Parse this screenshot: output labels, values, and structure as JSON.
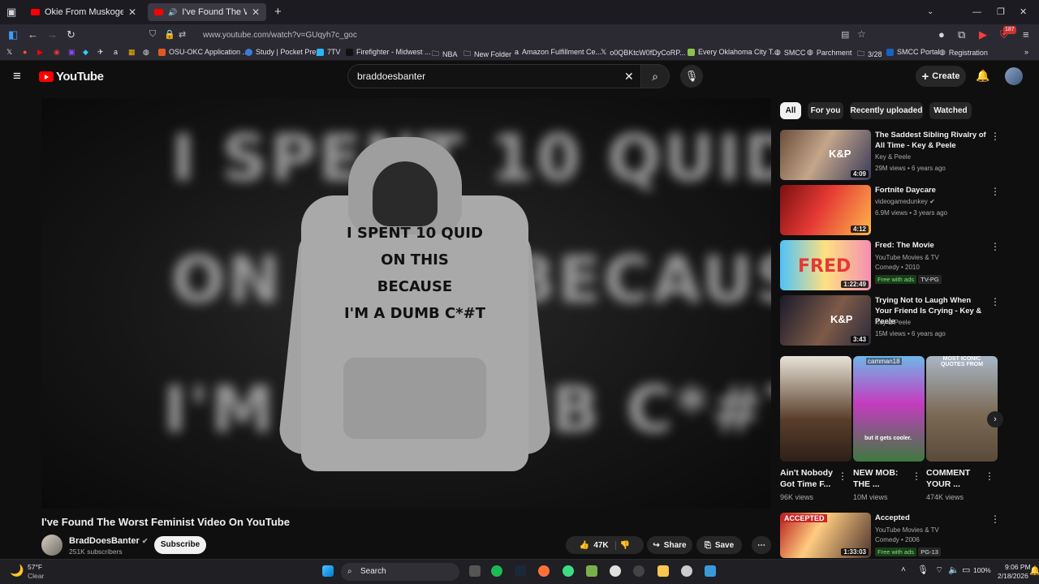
{
  "browser": {
    "tabs": [
      {
        "label": "Okie From Muskogee - YouTube"
      },
      {
        "label": "I've Found The Worst Femini"
      }
    ],
    "url": "www.youtube.com/watch?v=GUqyh7c_goc",
    "extension_badge": "187",
    "bookmarks": [
      {
        "label": "OSU-OKC Application ..."
      },
      {
        "label": "Study | Pocket Prep"
      },
      {
        "label": "7TV"
      },
      {
        "label": "Firefighter - Midwest ..."
      },
      {
        "label": "NBA"
      },
      {
        "label": "New Folder"
      },
      {
        "label": "Amazon Fulfillment Ce..."
      },
      {
        "label": "o0QBKtcW0fDyCoRP..."
      },
      {
        "label": "Every Oklahoma City T..."
      },
      {
        "label": "SMCC"
      },
      {
        "label": "Parchment"
      },
      {
        "label": "3/28"
      },
      {
        "label": "SMCC Portal"
      },
      {
        "label": "Registration"
      }
    ]
  },
  "youtube": {
    "logo": "YouTube",
    "search_query": "braddoesbanter",
    "create_label": "Create"
  },
  "video": {
    "blur_lines": [
      "I SPENT 10 QUID",
      "ON THIS BECAUSE",
      "I'M A DUMB C*#T"
    ],
    "hoodie_lines": [
      "I SPENT 10 QUID",
      "ON THIS BECAUSE",
      "I'M A DUMB C*#T"
    ],
    "title": "I've Found The Worst Feminist Video On YouTube",
    "channel": "BradDoesBanter",
    "subscribers": "251K subscribers",
    "subscribe_label": "Subscribe",
    "likes": "47K",
    "share_label": "Share",
    "save_label": "Save"
  },
  "sidebar": {
    "chips": [
      "All",
      "For you",
      "Recently uploaded",
      "Watched"
    ],
    "recs": [
      {
        "title": "The Saddest Sibling Rivalry of All Time - Key & Peele",
        "channel": "Key & Peele",
        "meta": "29M views • 6 years ago",
        "duration": "4:09"
      },
      {
        "title": "Fortnite Daycare",
        "channel": "videogamedunkey",
        "meta": "6.9M views • 3 years ago",
        "duration": "4:12"
      },
      {
        "title": "Fred: The Movie",
        "channel": "YouTube Movies & TV",
        "meta": "Comedy • 2010",
        "duration": "1:22:49",
        "badge1": "Free with ads",
        "badge2": "TV-PG"
      },
      {
        "title": "Trying Not to Laugh When Your Friend Is Crying - Key & Peele",
        "channel": "Key & Peele",
        "meta": "15M views • 6 years ago",
        "duration": "3:43"
      }
    ],
    "shorts": [
      {
        "title": "Ain't Nobody Got Time F...",
        "views": "96K views"
      },
      {
        "title": "NEW MOB: THE ...",
        "views": "10M views",
        "overlay": "but it gets cooler.",
        "tag": "camman18"
      },
      {
        "title": "COMMENT YOUR ...",
        "views": "474K views",
        "overlay": "MOST ICONIC QUOTES FROM"
      }
    ],
    "last_rec": {
      "title": "Accepted",
      "channel": "YouTube Movies & TV",
      "meta": "Comedy • 2006",
      "duration": "1:33:03",
      "badge1": "Free with ads",
      "badge2": "PG-13",
      "thumb_text": "ACCEPTED"
    }
  },
  "taskbar": {
    "weather_temp": "57°F",
    "weather_desc": "Clear",
    "search_label": "Search",
    "battery": "100%",
    "time": "9:06 PM",
    "date": "2/18/2026"
  },
  "colors": {
    "accent_red": "#ff0000",
    "bg": "#0f0f0f"
  }
}
